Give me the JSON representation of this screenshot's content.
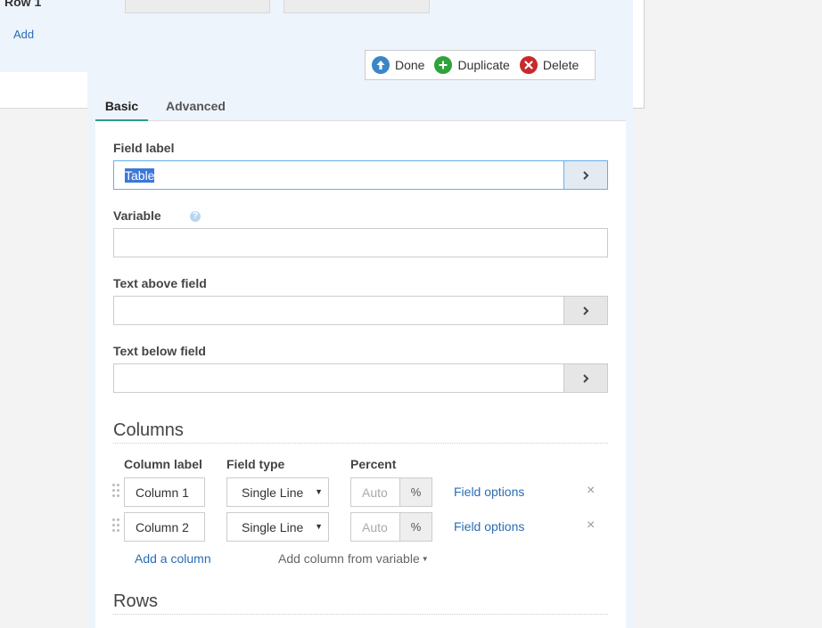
{
  "backdrop": {
    "row_title": "Row 1",
    "add_link": "Add"
  },
  "toolbar": {
    "done": "Done",
    "duplicate": "Duplicate",
    "delete": "Delete"
  },
  "tabs": [
    {
      "label": "Basic",
      "active": true
    },
    {
      "label": "Advanced",
      "active": false
    }
  ],
  "fields": {
    "field_label": {
      "label": "Field label",
      "value": "Table"
    },
    "variable": {
      "label": "Variable",
      "value": ""
    },
    "text_above": {
      "label": "Text above field",
      "value": ""
    },
    "text_below": {
      "label": "Text below field",
      "value": ""
    }
  },
  "columns": {
    "title": "Columns",
    "headers": {
      "label": "Column label",
      "type": "Field type",
      "percent": "Percent"
    },
    "rows": [
      {
        "label": "Column 1",
        "type": "Single Line",
        "percent_placeholder": "Auto",
        "percent_unit": "%",
        "options": "Field options",
        "remove": "×"
      },
      {
        "label": "Column 2",
        "type": "Single Line",
        "percent_placeholder": "Auto",
        "percent_unit": "%",
        "options": "Field options",
        "remove": "×"
      }
    ],
    "add_column": "Add a column",
    "add_from_variable": "Add column from variable"
  },
  "rows_section": {
    "title": "Rows"
  },
  "colors": {
    "accent": "#2a9d8f",
    "link": "#2a6db5",
    "done": "#3a86c8",
    "duplicate": "#2fa23a",
    "delete": "#c62a2a"
  }
}
